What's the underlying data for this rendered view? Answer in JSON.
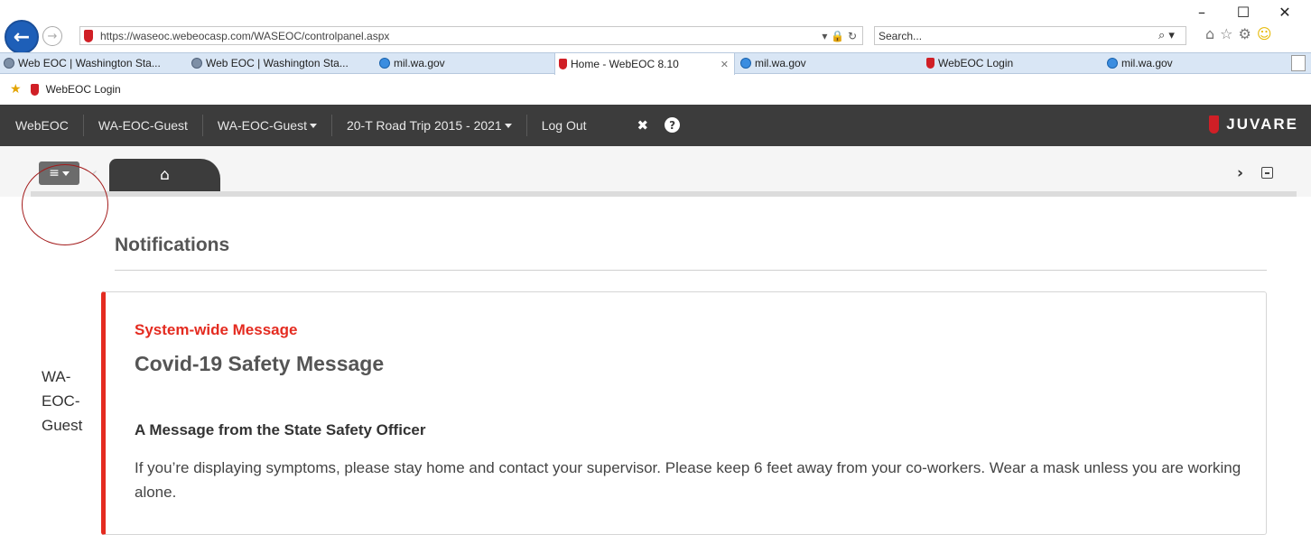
{
  "window": {
    "minimize": "–",
    "maximize": "☐",
    "close": "✕"
  },
  "browser": {
    "back_icon": "arrow-left-icon",
    "forward_icon": "arrow-right-icon",
    "url": "https://waseoc.webeocasp.com/WASEOC/controlpanel.aspx",
    "url_tools": "▾ 🔒 ↻",
    "search_placeholder": "Search...",
    "search_icon": "⌕ ▾",
    "toolbar_icons": [
      "⌂",
      "☆",
      "⚙",
      "☺"
    ]
  },
  "tabs": [
    {
      "label": "Web EOC | Washington Sta...",
      "icon": "globe",
      "active": false
    },
    {
      "label": "Web EOC | Washington Sta...",
      "icon": "globe",
      "active": false
    },
    {
      "label": "mil.wa.gov",
      "icon": "ie",
      "active": false
    },
    {
      "label": "Home - WebEOC 8.10",
      "icon": "red",
      "active": true,
      "close": "✕"
    },
    {
      "label": "mil.wa.gov",
      "icon": "ie",
      "active": false
    },
    {
      "label": "WebEOC Login",
      "icon": "red",
      "active": false
    },
    {
      "label": "mil.wa.gov",
      "icon": "ie",
      "active": false
    }
  ],
  "favorites": {
    "star": "★",
    "item": "WebEOC Login"
  },
  "navbar": {
    "items": [
      "WebEOC",
      "WA-EOC-Guest",
      "WA-EOC-Guest",
      "20-T Road Trip 2015 - 2021",
      "Log Out"
    ],
    "fullscreen_icon": "✖",
    "help_icon": "?",
    "brand": "JUVARE"
  },
  "toolbar": {
    "menu_icon": "≡",
    "left_arrow": "‹",
    "home_icon": "⌂",
    "right_arrow": "›"
  },
  "sidebar": {
    "user_lines": [
      "WA-",
      "EOC-",
      "Guest"
    ]
  },
  "main": {
    "title": "Notifications",
    "notification": {
      "kind": "System-wide Message",
      "title": "Covid-19 Safety Message",
      "subhead": "A Message from the State Safety Officer",
      "body": "If you’re displaying symptoms, please stay home and contact your supervisor. Please keep 6 feet away from your co-workers. Wear a mask unless you are working alone."
    }
  },
  "colors": {
    "navbar_bg": "#3c3c3c",
    "accent_red": "#e42b20",
    "tab_bar_bg": "#d9e6f5"
  }
}
